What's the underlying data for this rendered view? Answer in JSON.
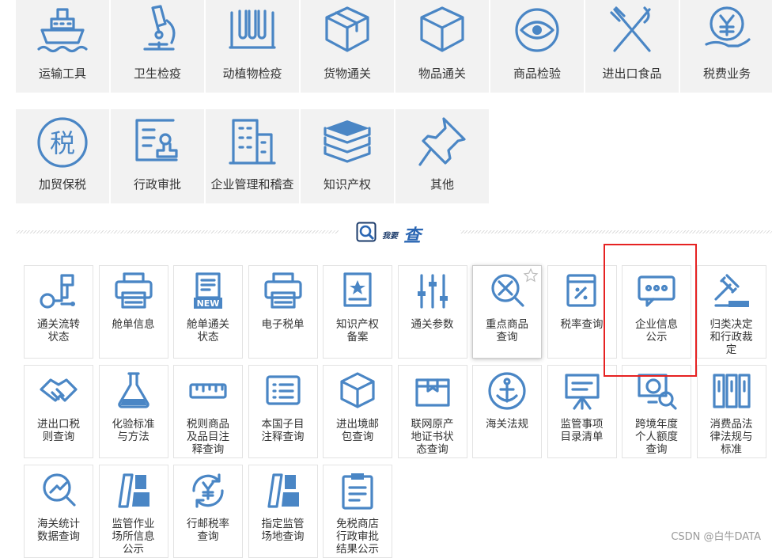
{
  "categories": [
    {
      "label": "运输工具",
      "icon": "ship-icon"
    },
    {
      "label": "卫生检疫",
      "icon": "microscope-icon"
    },
    {
      "label": "动植物检疫",
      "icon": "test-tubes-icon"
    },
    {
      "label": "货物通关",
      "icon": "cargo-box-icon"
    },
    {
      "label": "物品通关",
      "icon": "package-box-icon"
    },
    {
      "label": "商品检验",
      "icon": "eye-inspection-icon"
    },
    {
      "label": "进出口食品",
      "icon": "fork-knife-icon"
    },
    {
      "label": "税费业务",
      "icon": "yen-hand-icon"
    },
    {
      "label": "加贸保税",
      "icon": "tax-circle-icon"
    },
    {
      "label": "行政审批",
      "icon": "approval-stamp-icon"
    },
    {
      "label": "企业管理和稽查",
      "icon": "building-icon"
    },
    {
      "label": "知识产权",
      "icon": "books-icon"
    },
    {
      "label": "其他",
      "icon": "pushpin-icon"
    }
  ],
  "search_section": {
    "prefix": "我要",
    "title": "查",
    "icon": "search-q-icon"
  },
  "query_tiles": [
    {
      "label": "通关流转\n状态",
      "icon": "flow-network-icon"
    },
    {
      "label": "舱单信息",
      "icon": "printer-icon"
    },
    {
      "label": "舱单通关\n状态",
      "icon": "new-document-icon",
      "badge": "NEW"
    },
    {
      "label": "电子税单",
      "icon": "printer-icon"
    },
    {
      "label": "知识产权\n备案",
      "icon": "star-certificate-icon"
    },
    {
      "label": "通关参数",
      "icon": "sliders-icon"
    },
    {
      "label": "重点商品\n查询",
      "icon": "tools-magnifier-icon"
    },
    {
      "label": "税率查询",
      "icon": "rate-book-icon"
    },
    {
      "label": "企业信息\n公示",
      "icon": "chat-bubble-icon"
    },
    {
      "label": "归类决定\n和行政裁\n定",
      "icon": "gavel-icon"
    },
    {
      "label": "进出口税\n则查询",
      "icon": "handshake-icon"
    },
    {
      "label": "化验标准\n与方法",
      "icon": "flask-icon"
    },
    {
      "label": "税则商品\n及品目注\n释查询",
      "icon": "ruler-icon"
    },
    {
      "label": "本国子目\n注释查询",
      "icon": "list-card-icon"
    },
    {
      "label": "进出境邮\n包查询",
      "icon": "parcel-icon"
    },
    {
      "label": "联网原产\n地证书状\n态查询",
      "icon": "certificate-box-icon"
    },
    {
      "label": "海关法规",
      "icon": "anchor-icon"
    },
    {
      "label": "监管事项\n目录清单",
      "icon": "easel-icon"
    },
    {
      "label": "跨境年度\n个人额度\n查询",
      "icon": "globe-search-icon"
    },
    {
      "label": "消费品法\n律法规与\n标准",
      "icon": "binders-icon"
    },
    {
      "label": "海关统计\n数据查询",
      "icon": "stats-magnifier-icon"
    },
    {
      "label": "监管作业\n场所信息\n公示",
      "icon": "site-blocks-icon"
    },
    {
      "label": "行邮税率\n查询",
      "icon": "yen-refresh-icon"
    },
    {
      "label": "指定监管\n场地查询",
      "icon": "site-blocks-icon"
    },
    {
      "label": "免税商店\n行政审批\n结果公示",
      "icon": "clipboard-icon"
    }
  ],
  "watermark": "CSDN @白牛DATA",
  "colors": {
    "icon": "#4a86c5",
    "tile_bg": "#f2f2f2",
    "highlight": "#e62222"
  }
}
